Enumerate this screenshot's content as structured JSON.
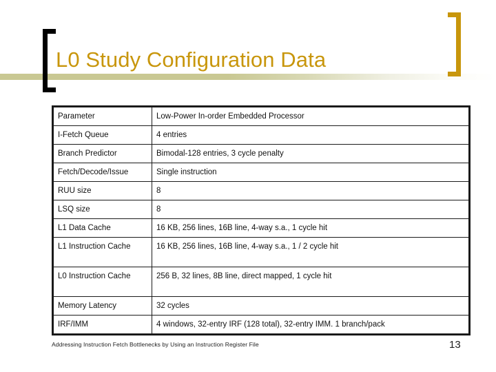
{
  "slide": {
    "title": "L0 Study Configuration Data",
    "title_color": "#c8960c",
    "rule_color": "#c9c893",
    "bracket_left_color": "#000000",
    "bracket_right_color": "#c8960c",
    "background": "#ffffff"
  },
  "table": {
    "columns": [
      "Parameter",
      "Low-Power In-order Embedded Processor"
    ],
    "rows": [
      {
        "parameter": "Parameter",
        "value": "Low-Power In-order Embedded Processor",
        "tall": false
      },
      {
        "parameter": "I-Fetch Queue",
        "value": "4 entries",
        "tall": false
      },
      {
        "parameter": "Branch Predictor",
        "value": "Bimodal-128 entries, 3 cycle penalty",
        "tall": false
      },
      {
        "parameter": "Fetch/Decode/Issue",
        "value": "Single instruction",
        "tall": false
      },
      {
        "parameter": "RUU size",
        "value": "8",
        "tall": false
      },
      {
        "parameter": "LSQ size",
        "value": "8",
        "tall": false
      },
      {
        "parameter": "L1 Data Cache",
        "value": "16 KB, 256 lines, 16B line, 4-way s.a., 1 cycle hit",
        "tall": false
      },
      {
        "parameter": "L1 Instruction Cache",
        "value": "16 KB, 256 lines, 16B line, 4-way s.a., 1 / 2 cycle hit",
        "tall": true
      },
      {
        "parameter": "L0 Instruction Cache",
        "value": "256 B, 32 lines, 8B line, direct mapped, 1 cycle hit",
        "tall": true
      },
      {
        "parameter": "Memory Latency",
        "value": "32 cycles",
        "tall": false
      },
      {
        "parameter": "IRF/IMM",
        "value": "4 windows, 32-entry IRF (128 total), 32-entry IMM. 1 branch/pack",
        "tall": false
      }
    ]
  },
  "footer": {
    "text": "Addressing Instruction Fetch Bottlenecks by Using an Instruction Register File",
    "page_number": "13"
  }
}
